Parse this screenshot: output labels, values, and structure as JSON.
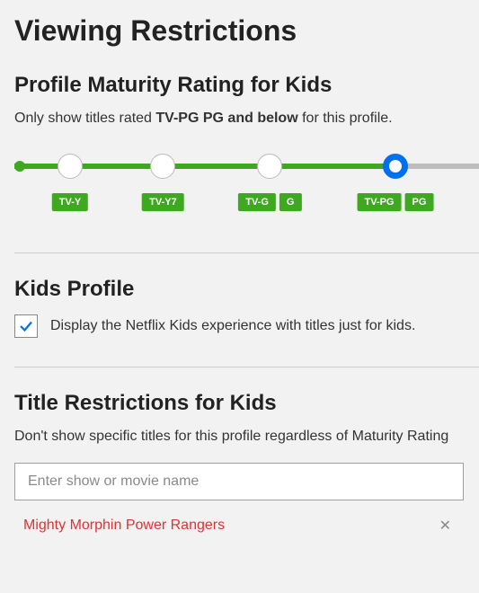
{
  "page_title": "Viewing Restrictions",
  "maturity": {
    "heading": "Profile Maturity Rating for Kids",
    "prefix": "Only show titles rated ",
    "selected_label": "TV-PG PG and below",
    "suffix": " for this profile.",
    "slider": {
      "stops": [
        {
          "pct": 12,
          "labels": [
            "TV-Y"
          ]
        },
        {
          "pct": 32,
          "labels": [
            "TV-Y7"
          ]
        },
        {
          "pct": 55,
          "labels": [
            "TV-G",
            "G"
          ]
        },
        {
          "pct": 82,
          "labels": [
            "TV-PG",
            "PG"
          ]
        }
      ],
      "active_index": 3,
      "colors": {
        "active": "#3ea821",
        "inactive": "#bdbdbd",
        "handle_active": "#0071eb"
      }
    }
  },
  "kids_profile": {
    "heading": "Kids Profile",
    "checkbox_checked": true,
    "checkbox_label": "Display the Netflix Kids experience with titles just for kids."
  },
  "title_restrictions": {
    "heading": "Title Restrictions for Kids",
    "subtext": "Don't show specific titles for this profile regardless of Maturity Rating",
    "search_placeholder": "Enter show or movie name",
    "restricted": [
      {
        "title": "Mighty Morphin Power Rangers"
      }
    ]
  }
}
